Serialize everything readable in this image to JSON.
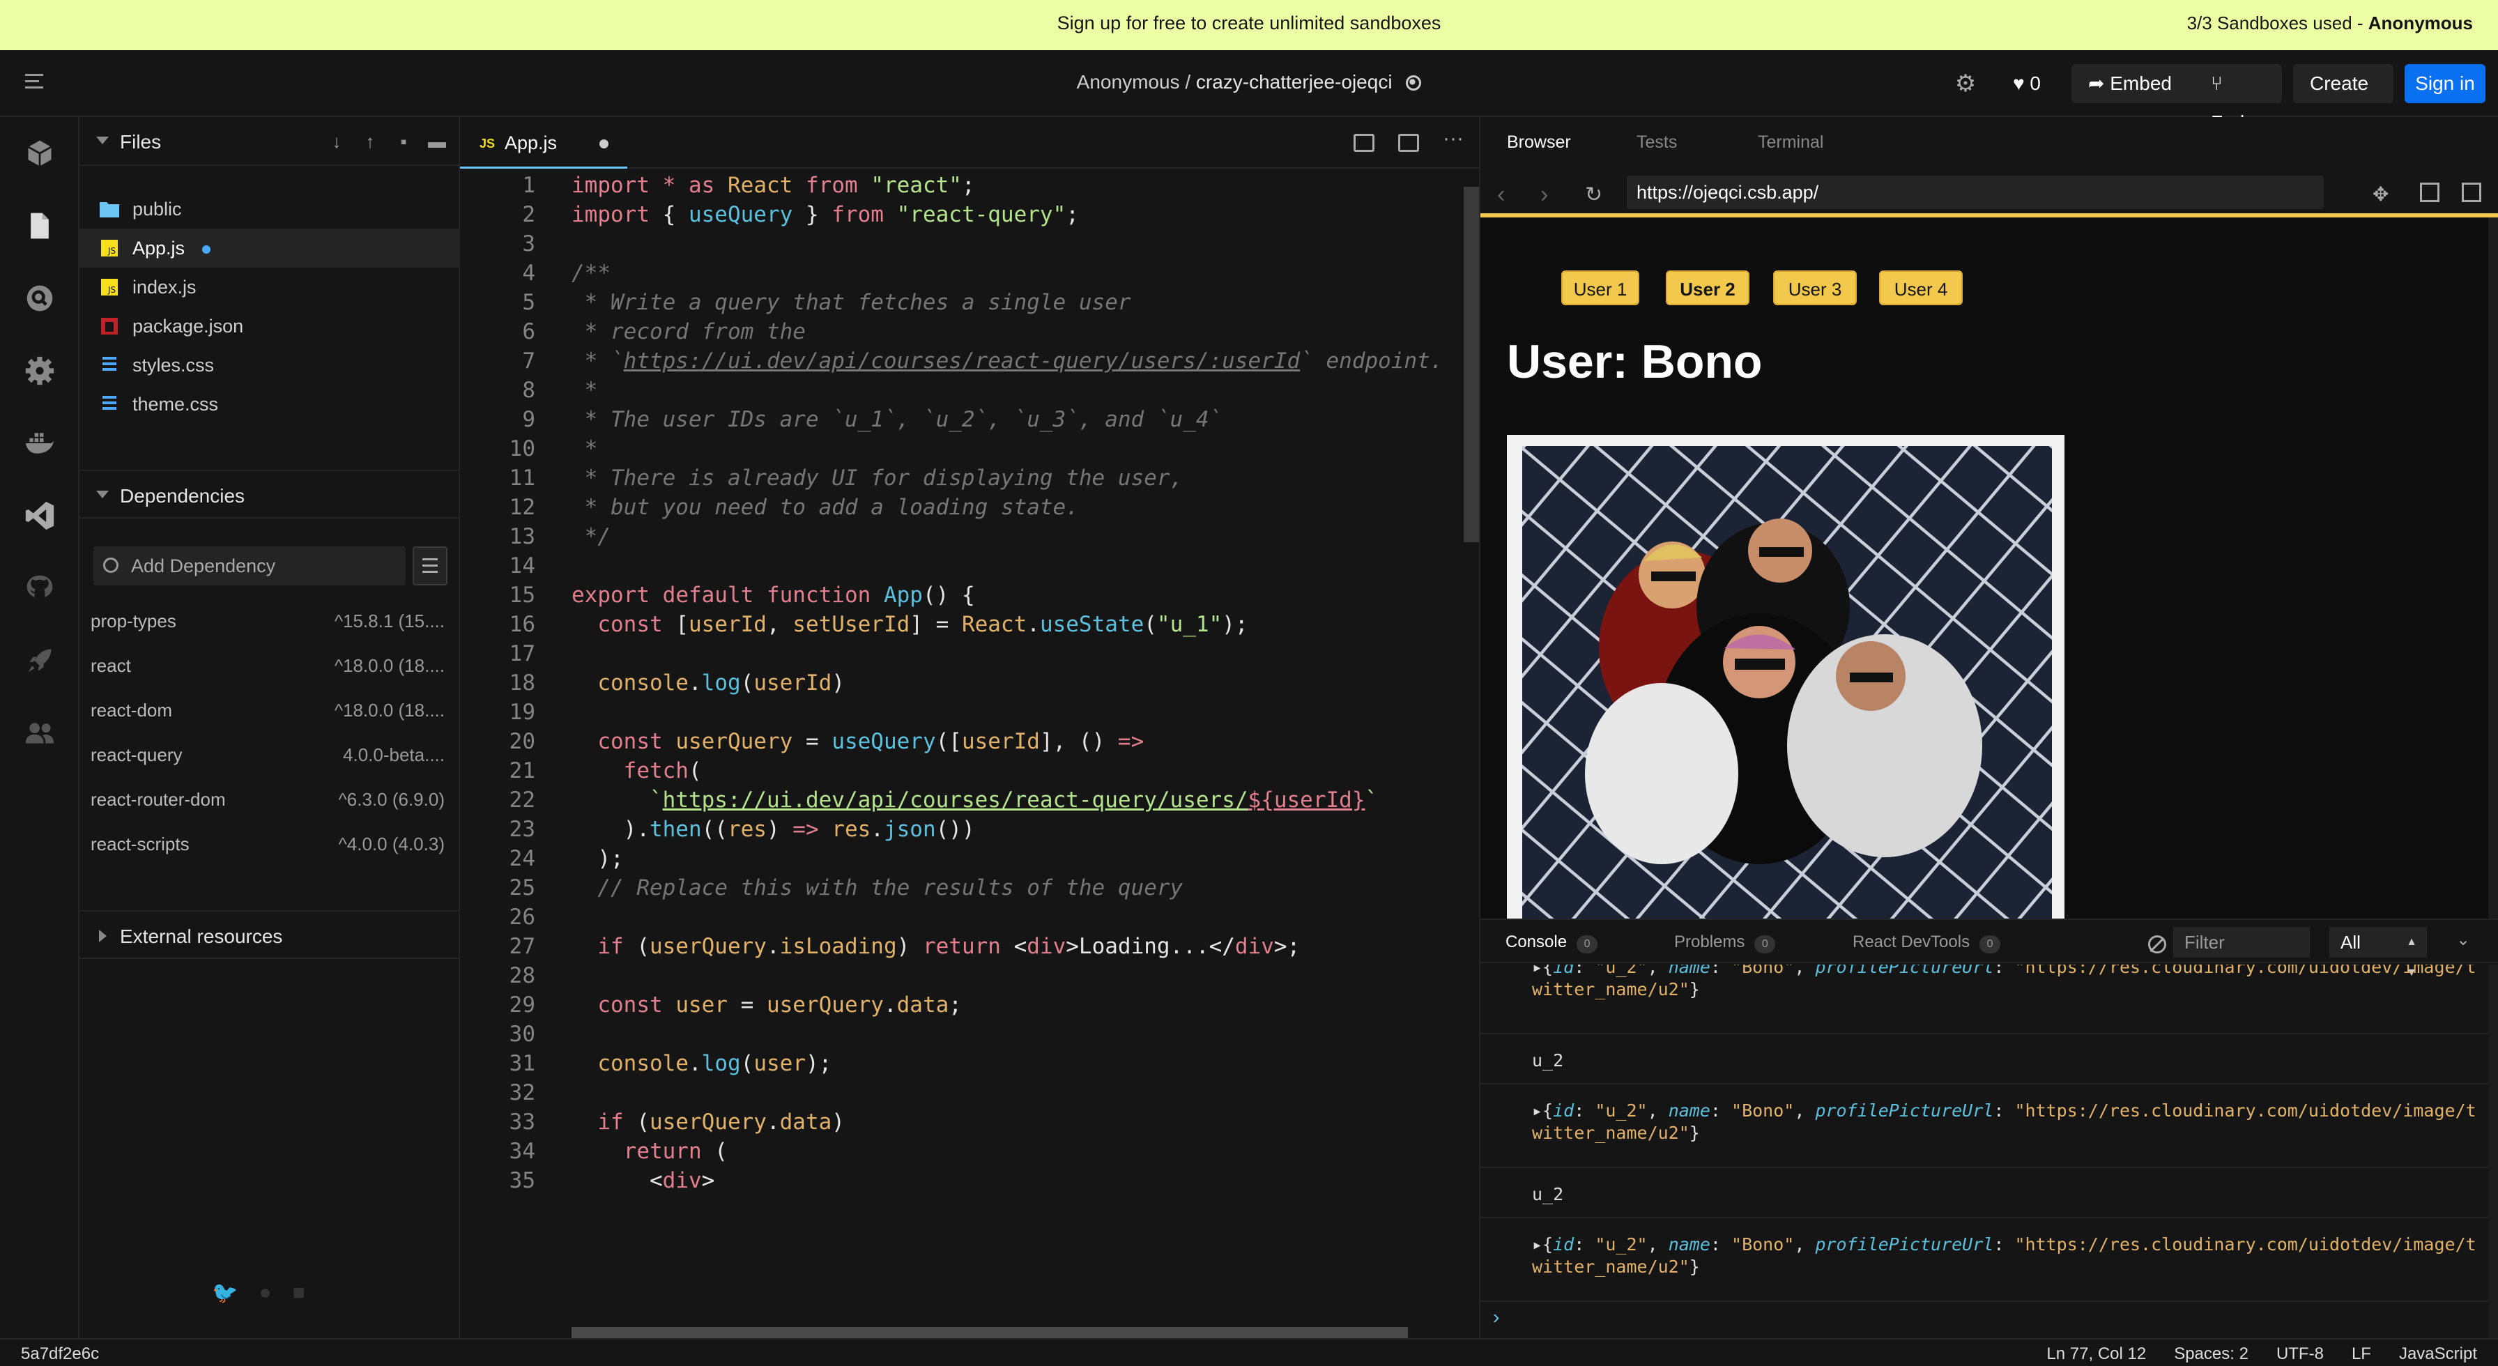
{
  "banner": {
    "message": "Sign up for free to create unlimited sandboxes",
    "usage_prefix": "3/3 Sandboxes used - ",
    "usage_user": "Anonymous"
  },
  "header": {
    "owner": "Anonymous /",
    "sandbox_name": "crazy-chatterjee-ojeqci",
    "like_count": "0",
    "embed_label": "Embed",
    "fork_label": "Fork",
    "create_label": "Create",
    "signin_label": "Sign in"
  },
  "explorer": {
    "files_title": "Files",
    "files": [
      {
        "name": "public",
        "icon": "folder-icon"
      },
      {
        "name": "App.js",
        "icon": "js-file-icon"
      },
      {
        "name": "index.js",
        "icon": "js-file-icon"
      },
      {
        "name": "package.json",
        "icon": "npm-file-icon"
      },
      {
        "name": "styles.css",
        "icon": "css-file-icon"
      },
      {
        "name": "theme.css",
        "icon": "css-file-icon"
      }
    ],
    "dependencies_title": "Dependencies",
    "add_dependency_placeholder": "Add Dependency",
    "dependencies": [
      {
        "name": "prop-types",
        "version": "^15.8.1 (15...."
      },
      {
        "name": "react",
        "version": "^18.0.0 (18...."
      },
      {
        "name": "react-dom",
        "version": "^18.0.0 (18...."
      },
      {
        "name": "react-query",
        "version": "4.0.0-beta...."
      },
      {
        "name": "react-router-dom",
        "version": "^6.3.0 (6.9.0)"
      },
      {
        "name": "react-scripts",
        "version": "^4.0.0 (4.0.3)"
      }
    ],
    "external_resources_title": "External resources"
  },
  "editor": {
    "tab_label": "App.js",
    "tab_badge": "JS"
  },
  "preview": {
    "tabs": [
      "Browser",
      "Tests",
      "Terminal"
    ],
    "url": "https://ojeqci.csb.app/",
    "user_buttons": [
      "User 1",
      "User 2",
      "User 3",
      "User 4"
    ],
    "selected_user": "User 2",
    "title": "User: Bono"
  },
  "console": {
    "tabs": [
      {
        "label": "Console",
        "count": "0"
      },
      {
        "label": "Problems",
        "count": "0"
      },
      {
        "label": "React DevTools",
        "count": "0"
      }
    ],
    "filter_placeholder": "Filter",
    "level": "All",
    "entries": [
      {
        "type": "obj",
        "id": "u_2",
        "name": "Bono",
        "url": "https://res.cloudinary.com/uidotdev/image/twitter_name/u2"
      },
      {
        "type": "text",
        "text": "u_2"
      },
      {
        "type": "obj",
        "id": "u_2",
        "name": "Bono",
        "url": "https://res.cloudinary.com/uidotdev/image/twitter_name/u2"
      },
      {
        "type": "text",
        "text": "u_2"
      },
      {
        "type": "obj",
        "id": "u_2",
        "name": "Bono",
        "url": "https://res.cloudinary.com/uidotdev/image/twitter_name/u2"
      }
    ]
  },
  "statusbar": {
    "commit": "5a7df2e6c",
    "cursor": "Ln 77, Col 12",
    "spaces": "Spaces: 2",
    "encoding": "UTF-8",
    "eol": "LF",
    "language": "JavaScript"
  },
  "code_lines": [
    "import * as React from \"react\";",
    "import { useQuery } from \"react-query\";",
    "",
    "/**",
    " * Write a query that fetches a single user",
    " * record from the",
    " * `https://ui.dev/api/courses/react-query/users/:userId` endpoint.",
    " *",
    " * The user IDs are `u_1`, `u_2`, `u_3`, and `u_4`",
    " *",
    " * There is already UI for displaying the user,",
    " * but you need to add a loading state.",
    " */",
    "",
    "export default function App() {",
    "  const [userId, setUserId] = React.useState(\"u_1\");",
    "",
    "  console.log(userId)",
    "",
    "  const userQuery = useQuery([userId], () =>",
    "    fetch(",
    "      `https://ui.dev/api/courses/react-query/users/${userId}`",
    "    ).then((res) => res.json())",
    "  );",
    "  // Replace this with the results of the query",
    "",
    "  if (userQuery.isLoading) return <div>Loading...</div>;",
    "",
    "  const user = userQuery.data;",
    "",
    "  console.log(user);",
    "",
    "  if (userQuery.data)",
    "    return (",
    "      <div>"
  ]
}
